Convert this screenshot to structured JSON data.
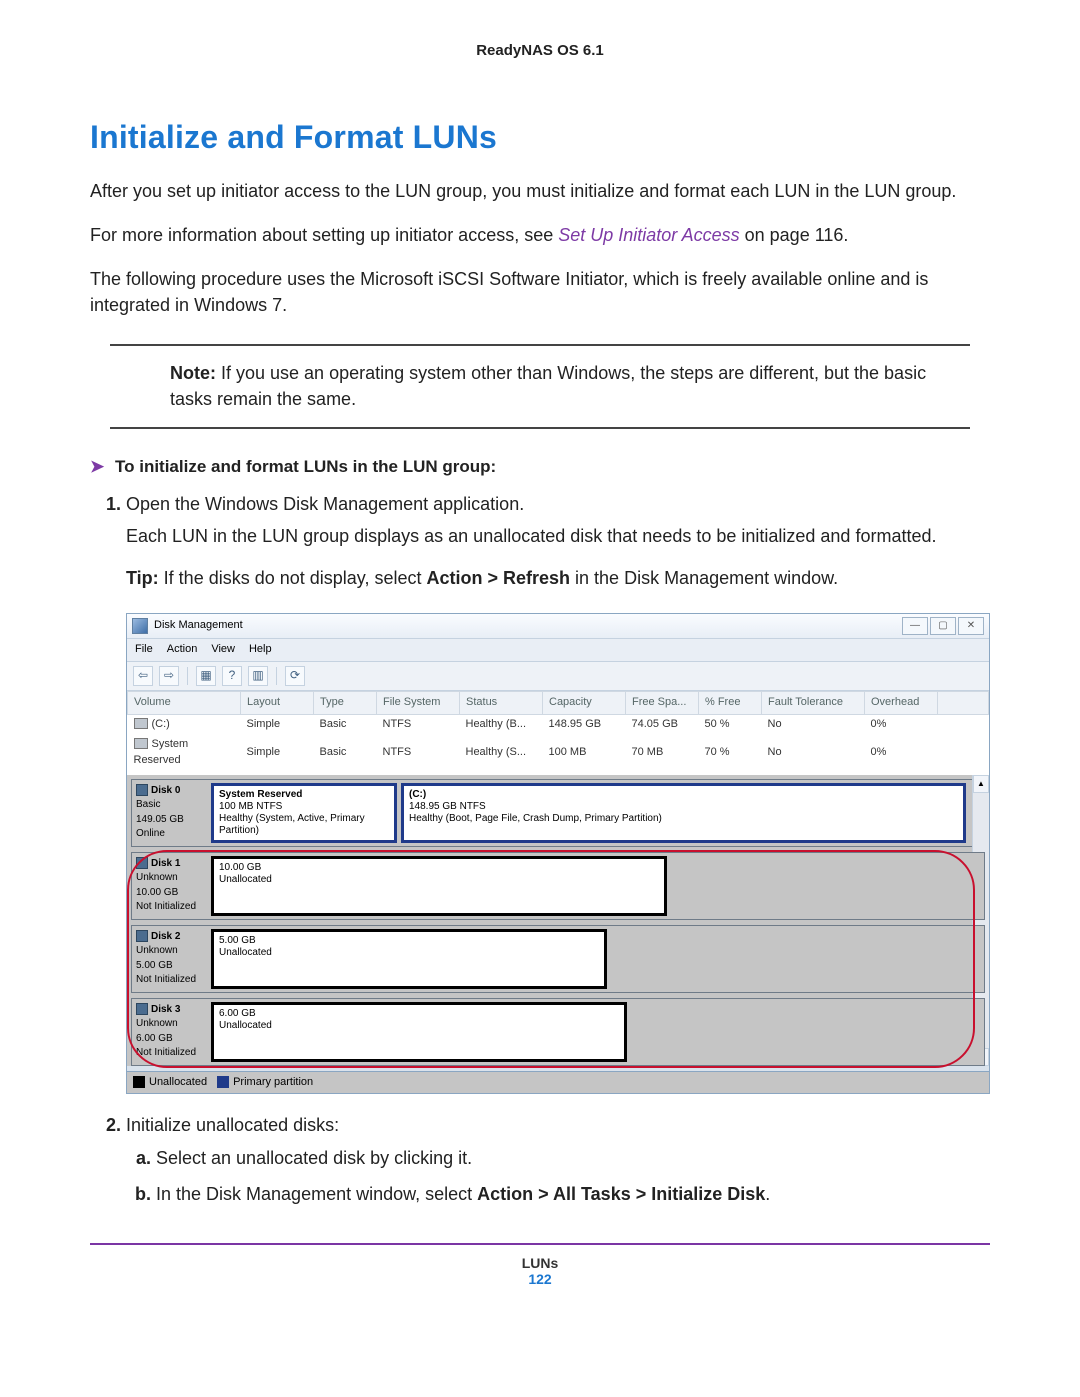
{
  "header": {
    "product": "ReadyNAS OS 6.1"
  },
  "title": "Initialize and Format LUNs",
  "para1": "After you set up initiator access to the LUN group, you must initialize and format each LUN in the LUN group.",
  "para2a": "For more information about setting up initiator access, see ",
  "para2_xref": "Set Up Initiator Access",
  "para2b": " on page 116.",
  "para3": "The following procedure uses the Microsoft iSCSI Software Initiator, which is freely available online and is integrated in Windows 7.",
  "note_label": "Note:",
  "note_text": " If you use an operating system other than Windows, the steps are different, but the basic tasks remain the same.",
  "proc_heading": "To initialize and format LUNs in the LUN group:",
  "step1": "Open the Windows Disk Management application.",
  "step1_body": "Each LUN in the LUN group displays as an unallocated disk that needs to be initialized and formatted.",
  "tip_label": "Tip:",
  "tip_text": " If the disks do not display, select ",
  "tip_bold": "Action > Refresh",
  "tip_tail": " in the Disk Management window.",
  "step2": "Initialize unallocated disks:",
  "step2a": "Select an unallocated disk by clicking it.",
  "step2b_a": "In the Disk Management window, select ",
  "step2b_bold": "Action > All Tasks > Initialize Disk",
  "step2b_b": ".",
  "dm": {
    "title": "Disk Management",
    "menu": {
      "file": "File",
      "action": "Action",
      "view": "View",
      "help": "Help"
    },
    "columns": {
      "volume": "Volume",
      "layout": "Layout",
      "type": "Type",
      "fs": "File System",
      "status": "Status",
      "capacity": "Capacity",
      "freespace": "Free Spa...",
      "pctfree": "% Free",
      "fault": "Fault Tolerance",
      "overhead": "Overhead"
    },
    "rows": [
      {
        "volume": "(C:)",
        "layout": "Simple",
        "type": "Basic",
        "fs": "NTFS",
        "status": "Healthy (B...",
        "capacity": "148.95 GB",
        "freespace": "74.05 GB",
        "pctfree": "50 %",
        "fault": "No",
        "overhead": "0%"
      },
      {
        "volume": "System Reserved",
        "layout": "Simple",
        "type": "Basic",
        "fs": "NTFS",
        "status": "Healthy (S...",
        "capacity": "100 MB",
        "freespace": "70 MB",
        "pctfree": "70 %",
        "fault": "No",
        "overhead": "0%"
      }
    ],
    "disks": {
      "d0": {
        "name": "Disk 0",
        "state": "Basic",
        "size": "149.05 GB",
        "status": "Online",
        "p0": {
          "title": "System Reserved",
          "size": "100 MB NTFS",
          "health": "Healthy (System, Active, Primary Partition)"
        },
        "p1": {
          "title": "(C:)",
          "size": "148.95 GB NTFS",
          "health": "Healthy (Boot, Page File, Crash Dump, Primary Partition)"
        }
      },
      "d1": {
        "name": "Disk 1",
        "state": "Unknown",
        "size": "10.00 GB",
        "status": "Not Initialized",
        "part_size": "10.00 GB",
        "part_state": "Unallocated"
      },
      "d2": {
        "name": "Disk 2",
        "state": "Unknown",
        "size": "5.00 GB",
        "status": "Not Initialized",
        "part_size": "5.00 GB",
        "part_state": "Unallocated"
      },
      "d3": {
        "name": "Disk 3",
        "state": "Unknown",
        "size": "6.00 GB",
        "status": "Not Initialized",
        "part_size": "6.00 GB",
        "part_state": "Unallocated"
      }
    },
    "legend": {
      "unalloc": "Unallocated",
      "primary": "Primary partition"
    }
  },
  "footer": {
    "section": "LUNs",
    "page": "122"
  }
}
